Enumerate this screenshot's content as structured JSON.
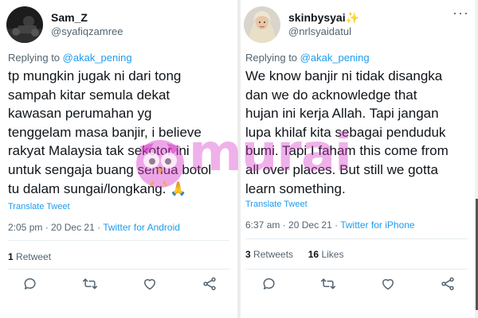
{
  "left_tweet": {
    "author_name": "Sam_Z",
    "author_handle": "@syafiqzamree",
    "replying_prefix": "Replying to",
    "replying_to": "@akak_pening",
    "body_lines": [
      "tp mungkin jugak ni dari tong",
      "sampah kitar semula dekat",
      "kawasan perumahan yg",
      "tenggelam masa banjir, i believe",
      "rakyat Malaysia tak sekotor ini",
      "untuk sengaja buang semua botol",
      "tu dalam sungai/longkang. 🙏"
    ],
    "translate_label": "Translate Tweet",
    "time": "2:05 pm",
    "date": "20 Dec 21",
    "source": "Twitter for Android",
    "retweets_count": "1",
    "retweets_label": "Retweet",
    "actions": [
      "reply-icon",
      "retweet-icon",
      "like-icon",
      "share-icon"
    ]
  },
  "right_tweet": {
    "author_name": "skinbysyai",
    "badge": "✨",
    "author_handle": "@nrlsyaidatul",
    "more_label": "···",
    "replying_prefix": "Replying to",
    "replying_to": "@akak_pening",
    "body_lines": [
      "We know banjir ni tidak disangka",
      "dan we do acknowledge that",
      "hujan ini kerja Allah. Tapi jangan",
      "lupa khilaf kita sebagai penduduk",
      "bumi. Tapi I faham this come from",
      "all over places. But still we gotta",
      "learn something."
    ],
    "translate_label": "Translate Tweet",
    "time": "6:37 am",
    "date": "20 Dec 21",
    "source": "Twitter for iPhone",
    "retweets_count": "3",
    "retweets_label": "Retweets",
    "likes_count": "16",
    "likes_label": "Likes",
    "actions": [
      "reply-icon",
      "retweet-icon",
      "like-icon",
      "share-icon"
    ]
  },
  "watermark": {
    "text": "murai"
  },
  "colors": {
    "link": "#1d9bf0",
    "secondary_text": "#536471",
    "primary_text": "#0f1419",
    "watermark": "#d63cc8"
  }
}
